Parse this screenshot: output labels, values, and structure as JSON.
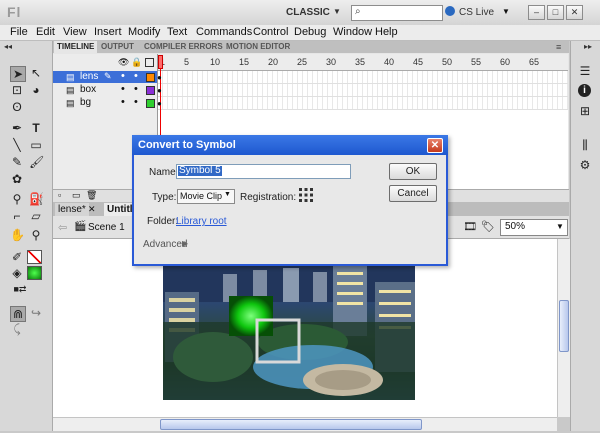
{
  "app": {
    "logo": "Fl",
    "workspace": "CLASSIC",
    "cs_live": "CS Live"
  },
  "menu": [
    "File",
    "Edit",
    "View",
    "Insert",
    "Modify",
    "Text",
    "Commands",
    "Control",
    "Debug",
    "Window",
    "Help"
  ],
  "panel_tabs": [
    "TIMELINE",
    "OUTPUT",
    "COMPILER ERRORS",
    "MOTION EDITOR"
  ],
  "timeline": {
    "ruler": [
      "1",
      "5",
      "10",
      "15",
      "20",
      "25",
      "30",
      "35",
      "40",
      "45",
      "50",
      "55",
      "60",
      "65"
    ],
    "layers": [
      {
        "name": "lens",
        "selected": true,
        "color": "#ff8a00"
      },
      {
        "name": "box",
        "selected": false,
        "color": "#8b2fd6"
      },
      {
        "name": "bg",
        "selected": false,
        "color": "#2fcf2f"
      }
    ]
  },
  "doc_tabs": [
    "lense*",
    "Untitle"
  ],
  "scene": {
    "label": "Scene 1",
    "zoom": "50%"
  },
  "dialog": {
    "title": "Convert to Symbol",
    "name_label": "Name:",
    "name_value": "Symbol 5",
    "type_label": "Type:",
    "type_value": "Movie Clip",
    "registration_label": "Registration:",
    "folder_label": "Folder:",
    "folder_value": "Library root",
    "advanced_label": "Advanced",
    "ok_label": "OK",
    "cancel_label": "Cancel"
  },
  "colors": {
    "accent": "#2a5ad7",
    "selection": "#3c6fd8"
  }
}
